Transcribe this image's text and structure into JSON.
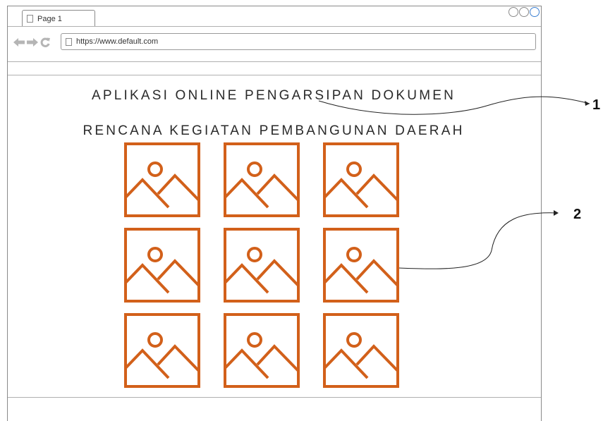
{
  "browser": {
    "tab_label": "Page 1",
    "url": "https://www.default.com",
    "nav_icons": [
      "back-arrow-icon",
      "forward-arrow-icon",
      "reload-icon"
    ],
    "window_buttons": [
      "minimize",
      "maximize",
      "close"
    ]
  },
  "page": {
    "title_line1": "APLIKASI ONLINE PENGARSIPAN DOKUMEN",
    "title_line2": "RENCANA KEGIATAN PEMBANGUNAN DAERAH",
    "image_grid": {
      "rows": 3,
      "cols": 3,
      "icon": "image-placeholder-icon",
      "color": "#d2601a"
    }
  },
  "annotations": [
    {
      "label": "1"
    },
    {
      "label": "2"
    }
  ]
}
